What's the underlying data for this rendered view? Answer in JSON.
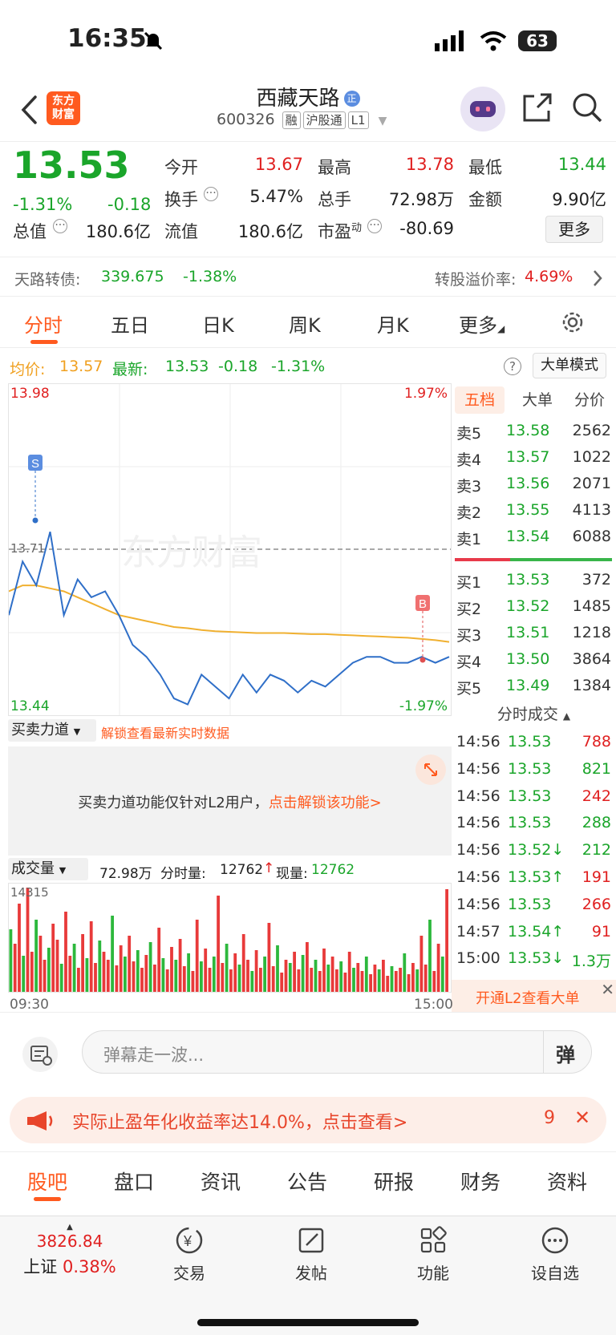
{
  "status_bar": {
    "time": "16:35",
    "battery": "63"
  },
  "header": {
    "logo_text": "东方\n财富",
    "stock_name": "西藏天路",
    "name_badge": "正",
    "code": "600326",
    "tags": [
      "融",
      "沪股通",
      "L1"
    ]
  },
  "quote": {
    "price": "13.53",
    "change_pct": "-1.31%",
    "change": "-0.18",
    "open_label": "今开",
    "open": "13.67",
    "high_label": "最高",
    "high": "13.78",
    "low_label": "最低",
    "low": "13.44",
    "turnover_label": "换手",
    "turnover": "5.47%",
    "volume_label": "总手",
    "volume": "72.98万",
    "amount_label": "金额",
    "amount": "9.90亿",
    "mktcap_label": "总值",
    "mktcap": "180.6亿",
    "float_label": "流值",
    "float": "180.6亿",
    "pe_label": "市盈",
    "pe_sup": "动",
    "pe": "-80.69",
    "more_button": "更多"
  },
  "bond": {
    "label": "天路转债:",
    "price": "339.675",
    "change": "-1.38%",
    "premium_label": "转股溢价率:",
    "premium": "4.69%"
  },
  "chart_tabs": [
    "分时",
    "五日",
    "日K",
    "周K",
    "月K",
    "更多"
  ],
  "avg_line": {
    "avg_label": "均价:",
    "avg": "13.57",
    "last_label": "最新:",
    "last": "13.53",
    "chg": "-0.18",
    "pct": "-1.31%",
    "big_order_button": "大单模式"
  },
  "chart_labels": {
    "top_price": "13.98",
    "bottom_price": "13.44",
    "top_pct": "1.97%",
    "bottom_pct": "-1.97%",
    "ref_price": "13.71",
    "watermark": "东方财富",
    "start_time": "09:30",
    "end_time": "15:00",
    "marker_s": "S",
    "marker_b": "B"
  },
  "chart_data": {
    "type": "line",
    "series": [
      {
        "name": "均价",
        "values": [
          13.64,
          13.65,
          13.65,
          13.645,
          13.64,
          13.63,
          13.62,
          13.61,
          13.6,
          13.595,
          13.59,
          13.585,
          13.58,
          13.578,
          13.575,
          13.573,
          13.572,
          13.571,
          13.57,
          13.57,
          13.57,
          13.569,
          13.568,
          13.568,
          13.567,
          13.566,
          13.565,
          13.564,
          13.563,
          13.562,
          13.56,
          13.558,
          13.555
        ]
      },
      {
        "name": "最新",
        "values": [
          13.6,
          13.69,
          13.65,
          13.74,
          13.6,
          13.66,
          13.63,
          13.64,
          13.6,
          13.55,
          13.53,
          13.5,
          13.46,
          13.45,
          13.5,
          13.48,
          13.46,
          13.5,
          13.47,
          13.5,
          13.49,
          13.47,
          13.49,
          13.48,
          13.5,
          13.52,
          13.53,
          13.53,
          13.52,
          13.52,
          13.53,
          13.52,
          13.53
        ]
      }
    ],
    "ylim": [
      13.44,
      13.98
    ]
  },
  "order_book": {
    "tabs": [
      "五档",
      "大单",
      "分价"
    ],
    "asks": [
      {
        "label": "卖5",
        "price": "13.58",
        "vol": "2562"
      },
      {
        "label": "卖4",
        "price": "13.57",
        "vol": "1022"
      },
      {
        "label": "卖3",
        "price": "13.56",
        "vol": "2071"
      },
      {
        "label": "卖2",
        "price": "13.55",
        "vol": "4113"
      },
      {
        "label": "卖1",
        "price": "13.54",
        "vol": "6088"
      }
    ],
    "bids": [
      {
        "label": "买1",
        "price": "13.53",
        "vol": "372"
      },
      {
        "label": "买2",
        "price": "13.52",
        "vol": "1485"
      },
      {
        "label": "买3",
        "price": "13.51",
        "vol": "1218"
      },
      {
        "label": "买4",
        "price": "13.50",
        "vol": "3864"
      },
      {
        "label": "买5",
        "price": "13.49",
        "vol": "1384"
      }
    ]
  },
  "trades": {
    "title": "分时成交",
    "rows": [
      {
        "time": "14:56",
        "price": "13.53",
        "vol": "788"
      },
      {
        "time": "14:56",
        "price": "13.53",
        "vol": "821"
      },
      {
        "time": "14:56",
        "price": "13.53",
        "vol": "242"
      },
      {
        "time": "14:56",
        "price": "13.53",
        "vol": "288"
      },
      {
        "time": "14:56",
        "price": "13.52↓",
        "vol": "212"
      },
      {
        "time": "14:56",
        "price": "13.53↑",
        "vol": "191"
      },
      {
        "time": "14:56",
        "price": "13.53",
        "vol": "266"
      },
      {
        "time": "14:57",
        "price": "13.54↑",
        "vol": "91"
      },
      {
        "time": "15:00",
        "price": "13.53↓",
        "vol": "1.3万"
      }
    ],
    "l2_link": "开通L2查看大单"
  },
  "force": {
    "select": "买卖力道",
    "unlock": "解锁查看最新实时数据",
    "notice": "买卖力道功能仅针对L2用户，",
    "notice_link": "点击解锁该功能>"
  },
  "volume": {
    "select": "成交量",
    "total": "72.98万",
    "min_label": "分时量:",
    "min_vol": "12762",
    "now_label": "现量:",
    "now_vol": "12762",
    "max": "14315"
  },
  "comment": {
    "placeholder": "弹幕走一波..."
  },
  "ad": {
    "text": "实际止盈年化收益率达14.0%，点击查看>",
    "count": "9"
  },
  "footer_tabs": [
    "股吧",
    "盘口",
    "资讯",
    "公告",
    "研报",
    "财务",
    "资料"
  ],
  "bottom_nav": {
    "index_value": "3826.84",
    "index_name": "上证",
    "index_pct": "0.38%",
    "items": [
      "交易",
      "发帖",
      "功能",
      "设自选"
    ]
  },
  "colors": {
    "up": "#e02020",
    "down": "#1aa52a",
    "accent": "#ff6a00",
    "avg_line": "#f0b030",
    "price_line": "#2f6fc8"
  }
}
